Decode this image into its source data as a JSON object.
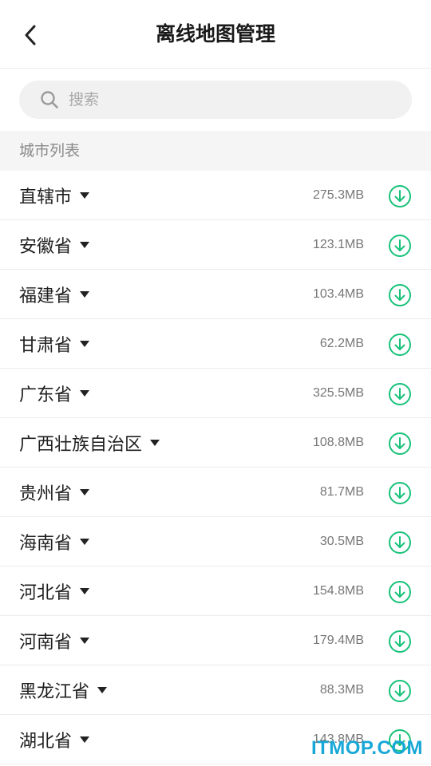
{
  "header": {
    "title": "离线地图管理",
    "back_icon": "chevron-left-icon"
  },
  "search": {
    "placeholder": "搜索",
    "value": "",
    "icon": "search-icon"
  },
  "section": {
    "label": "城市列表"
  },
  "cities": [
    {
      "name": "直辖市",
      "size": "275.3MB"
    },
    {
      "name": "安徽省",
      "size": "123.1MB"
    },
    {
      "name": "福建省",
      "size": "103.4MB"
    },
    {
      "name": "甘肃省",
      "size": "62.2MB"
    },
    {
      "name": "广东省",
      "size": "325.5MB"
    },
    {
      "name": "广西壮族自治区",
      "size": "108.8MB"
    },
    {
      "name": "贵州省",
      "size": "81.7MB"
    },
    {
      "name": "海南省",
      "size": "30.5MB"
    },
    {
      "name": "河北省",
      "size": "154.8MB"
    },
    {
      "name": "河南省",
      "size": "179.4MB"
    },
    {
      "name": "黑龙江省",
      "size": "88.3MB"
    },
    {
      "name": "湖北省",
      "size": "143.8MB"
    }
  ],
  "colors": {
    "accent": "#19c27a"
  },
  "watermark": "ITMOP.COM"
}
